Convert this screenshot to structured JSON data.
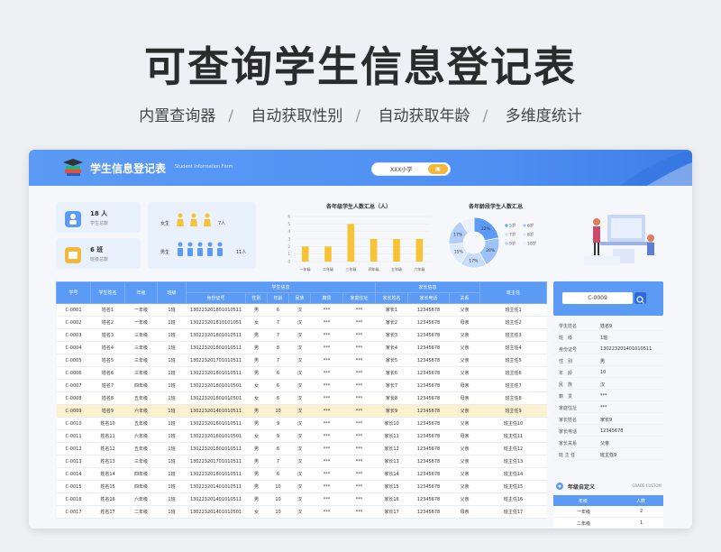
{
  "hero": {
    "title": "可查询学生信息登记表",
    "features": [
      "内置查询器",
      "自动获取性别",
      "自动获取年龄",
      "多维度统计"
    ]
  },
  "app": {
    "title": "学生信息登记表",
    "subtitle": "Student Information Form",
    "school": "XXX小学",
    "school_button": "▣"
  },
  "stats": {
    "students_value": "18 人",
    "students_label": "学生总数",
    "classes_value": "6 班",
    "classes_label": "班级总数",
    "female_label": "女生",
    "female_count": "7人",
    "male_label": "男生",
    "male_count": "11人"
  },
  "chart_data": [
    {
      "type": "bar",
      "title": "各年级学生人数汇总（人）",
      "categories": [
        "一年级",
        "二年级",
        "三年级",
        "四年级",
        "五年级",
        "六年级"
      ],
      "values": [
        2,
        2,
        5,
        3,
        3,
        3
      ],
      "ylim": [
        0,
        6
      ],
      "yticks": [
        0,
        1,
        2,
        3,
        4,
        5,
        6
      ],
      "color": "#f7c234"
    },
    {
      "type": "pie",
      "title": "各年龄段学生人数汇总",
      "slices": [
        {
          "label": "22%",
          "value": 22,
          "color": "#5b9bf5"
        },
        {
          "label": "20%",
          "value": 20,
          "color": "#9cc2f9"
        },
        {
          "label": "17%",
          "value": 17,
          "color": "#c7dcfb"
        },
        {
          "label": "15%",
          "value": 15,
          "color": "#dde9fc"
        },
        {
          "label": "17%",
          "value": 17,
          "color": "#b1cff9"
        },
        {
          "label": "",
          "value": 9,
          "color": "#eaf2fe"
        }
      ],
      "legend": [
        "5岁",
        "6岁",
        "7岁",
        "8岁",
        "9岁",
        "10岁"
      ]
    }
  ],
  "table": {
    "headers_top": [
      "学号",
      "学生姓名",
      "年级",
      "班级",
      "学生信息",
      "家长信息",
      "班主任"
    ],
    "headers_sub": [
      "身份证号",
      "性别",
      "年龄",
      "民族",
      "籍贯",
      "家庭住址",
      "家长姓名",
      "家长电话",
      "关系"
    ],
    "rows": [
      [
        "C-0001",
        "姓名1",
        "一年级",
        "1班",
        "130223201801010511",
        "男",
        "6",
        "汉",
        "***",
        "***",
        "家长1",
        "12345678",
        "父亲",
        "班主任1"
      ],
      [
        "C-0002",
        "姓名2",
        "一年级",
        "1班",
        "130223201810101051",
        "女",
        "7",
        "汉",
        "***",
        "***",
        "家长2",
        "12345678",
        "母亲",
        "班主任2"
      ],
      [
        "C-0003",
        "姓名3",
        "三年级",
        "1班",
        "130223201801010511",
        "男",
        "7",
        "汉",
        "***",
        "***",
        "家长3",
        "12345678",
        "父亲",
        "班主任3"
      ],
      [
        "C-0004",
        "姓名4",
        "三年级",
        "1班",
        "130223201801010511",
        "男",
        "8",
        "汉",
        "***",
        "***",
        "家长4",
        "12345678",
        "父亲",
        "班主任4"
      ],
      [
        "C-0005",
        "姓名5",
        "三年级",
        "1班",
        "130223201701010511",
        "男",
        "7",
        "汉",
        "***",
        "***",
        "家长5",
        "12345678",
        "父亲",
        "班主任5"
      ],
      [
        "C-0006",
        "姓名6",
        "三年级",
        "1班",
        "130223201801010511",
        "男",
        "6",
        "汉",
        "***",
        "***",
        "家长6",
        "12345678",
        "父亲",
        "班主任6"
      ],
      [
        "C-0007",
        "姓名7",
        "四年级",
        "1班",
        "130223201801010501",
        "女",
        "6",
        "汉",
        "***",
        "***",
        "家长7",
        "12345678",
        "母亲",
        "班主任7"
      ],
      [
        "C-0008",
        "姓名8",
        "五年级",
        "1班",
        "130223201801010501",
        "女",
        "6",
        "汉",
        "***",
        "***",
        "家长8",
        "12345678",
        "母亲",
        "班主任8"
      ],
      [
        "C-0009",
        "姓名9",
        "六年级",
        "1班",
        "130223201401010511",
        "男",
        "10",
        "汉",
        "***",
        "***",
        "家长9",
        "12345678",
        "父亲",
        "班主任9"
      ],
      [
        "C-0010",
        "姓名10",
        "五年级",
        "1班",
        "130223201601010511",
        "男",
        "9",
        "汉",
        "***",
        "***",
        "家长10",
        "12345678",
        "父亲",
        "班主任10"
      ],
      [
        "C-0011",
        "姓名11",
        "六年级",
        "1班",
        "130223201601010501",
        "女",
        "9",
        "汉",
        "***",
        "***",
        "家长11",
        "12345678",
        "母亲",
        "班主任11"
      ],
      [
        "C-0012",
        "姓名12",
        "五年级",
        "1班",
        "130223201801010511",
        "男",
        "6",
        "汉",
        "***",
        "***",
        "家长12",
        "12345678",
        "父亲",
        "班主任12"
      ],
      [
        "C-0013",
        "姓名13",
        "三年级",
        "1班",
        "130223201701010511",
        "男",
        "7",
        "汉",
        "***",
        "***",
        "家长13",
        "12345678",
        "父亲",
        "班主任13"
      ],
      [
        "C-0014",
        "姓名14",
        "四年级",
        "1班",
        "130223201801010511",
        "男",
        "6",
        "汉",
        "***",
        "***",
        "家长14",
        "12345678",
        "父亲",
        "班主任14"
      ],
      [
        "C-0015",
        "姓名15",
        "四年级",
        "1班",
        "130223201401010511",
        "男",
        "10",
        "汉",
        "***",
        "***",
        "家长15",
        "12345678",
        "父亲",
        "班主任15"
      ],
      [
        "C-0016",
        "姓名16",
        "六年级",
        "1班",
        "130223201401010511",
        "男",
        "10",
        "汉",
        "***",
        "***",
        "家长16",
        "12345678",
        "父亲",
        "班主任16"
      ],
      [
        "C-0017",
        "姓名17",
        "二年级",
        "1班",
        "130223201401010501",
        "女",
        "10",
        "汉",
        "***",
        "***",
        "家长17",
        "12345678",
        "母亲",
        "班主任17"
      ]
    ],
    "highlight_index": 8
  },
  "search": {
    "value": "C-0009"
  },
  "detail": [
    {
      "k": "学生姓名",
      "v": "姓名9"
    },
    {
      "k": "班　级",
      "v": "1班"
    },
    {
      "k": "身份证号",
      "v": "130223201401010511"
    },
    {
      "k": "性　别",
      "v": "男"
    },
    {
      "k": "年　龄",
      "v": "10"
    },
    {
      "k": "民　族",
      "v": "汉"
    },
    {
      "k": "籍　贯",
      "v": "***"
    },
    {
      "k": "家庭住址",
      "v": "***"
    },
    {
      "k": "家长姓名",
      "v": "家长9"
    },
    {
      "k": "家长电话",
      "v": "12345678"
    },
    {
      "k": "家长关系",
      "v": "父亲"
    },
    {
      "k": "班 主 任",
      "v": "班主任9"
    }
  ],
  "grade_custom": {
    "title": "年级自定义",
    "subtitle": "GRADE CUSTOM",
    "col1": "年级",
    "col2": "人数",
    "rows": [
      {
        "grade": "一年级",
        "count": "2"
      },
      {
        "grade": "二年级",
        "count": "1"
      }
    ]
  },
  "colors": {
    "primary": "#5b9bf5",
    "accent": "#f7c234",
    "highlight": "#fcf1cf"
  }
}
